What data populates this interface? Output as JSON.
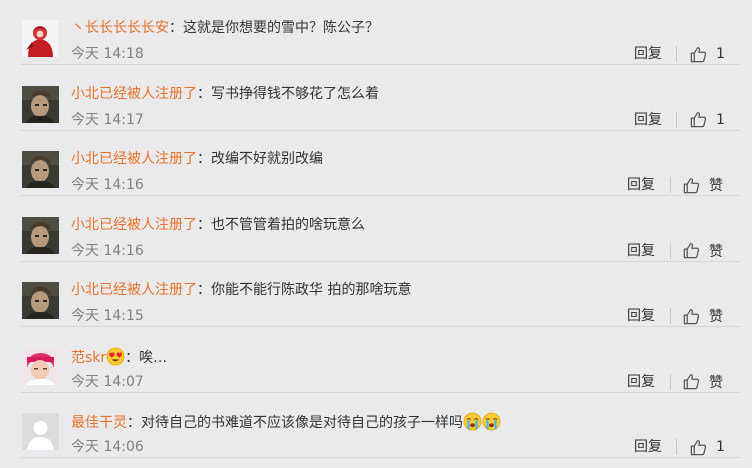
{
  "comments": [
    {
      "user": "丶长长长长长安",
      "avatar": "red-figure",
      "text": "这就是你想要的雪中？陈公子？",
      "time": "今天 14:18",
      "reply": "回复",
      "like": "1"
    },
    {
      "user": "小北已经被人注册了",
      "avatar": "portrait",
      "text": "写书挣得钱不够花了怎么着",
      "time": "今天 14:17",
      "reply": "回复",
      "like": "1"
    },
    {
      "user": "小北已经被人注册了",
      "avatar": "portrait",
      "text": "改编不好就别改编",
      "time": "今天 14:16",
      "reply": "回复",
      "like": "赞"
    },
    {
      "user": "小北已经被人注册了",
      "avatar": "portrait",
      "text": "也不管管着拍的啥玩意么",
      "time": "今天 14:16",
      "reply": "回复",
      "like": "赞"
    },
    {
      "user": "小北已经被人注册了",
      "avatar": "portrait",
      "text": "你能不能行陈政华 拍的那啥玩意",
      "time": "今天 14:15",
      "reply": "回复",
      "like": "赞"
    },
    {
      "user": "范skr",
      "avatar": "pink-hair",
      "user_badge": "heart-eyes-emoji",
      "text": "唉…",
      "time": "今天 14:07",
      "reply": "回复",
      "like": "赞"
    },
    {
      "user": "最佳干灵",
      "avatar": "default-gray",
      "text": "对待自己的书难道不应该像是对待自己的孩子一样吗",
      "text_emojis": [
        "crying-emoji",
        "crying-emoji"
      ],
      "time": "今天 14:06",
      "reply": "回复",
      "like": "1"
    }
  ],
  "colors": {
    "username": "#e8722b",
    "background": "#eaeaec",
    "time": "#808080"
  }
}
